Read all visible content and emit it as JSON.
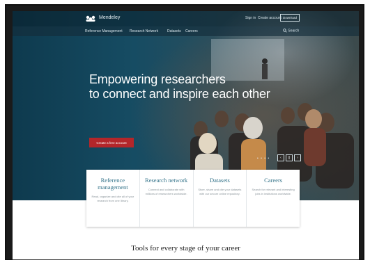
{
  "brand": {
    "logo_text": "Mendeley",
    "logo_icon": "mendeley-logo-icon"
  },
  "topbar": {
    "sign_in": "Sign in",
    "create_account": "Create account",
    "download": "Download"
  },
  "nav": {
    "items": [
      "Reference Management",
      "Research Network",
      "Datasets",
      "Careers"
    ],
    "search_label": "Search",
    "search_icon": "search-icon"
  },
  "hero": {
    "headline_line1": "Empowering researchers",
    "headline_line2": "to connect and inspire each other",
    "cta_label": "Create a free account",
    "slider": {
      "dots": "• • • •",
      "prev": "‹",
      "pause": "||",
      "next": "›"
    }
  },
  "cards": [
    {
      "title": "Reference management",
      "description": "Read, organize and cite all of your research from one library."
    },
    {
      "title": "Research network",
      "description": "Connect and collaborate with millions of researchers worldwide."
    },
    {
      "title": "Datasets",
      "description": "Store, share and cite your datasets with our secure online repository."
    },
    {
      "title": "Careers",
      "description": "Search for relevant and interesting jobs in institutions worldwide."
    }
  ],
  "tools_heading": "Tools for every stage of your career",
  "colors": {
    "accent_red": "#b3262a",
    "card_title": "#2e6f86",
    "hero_dark": "#0e3a4e"
  }
}
